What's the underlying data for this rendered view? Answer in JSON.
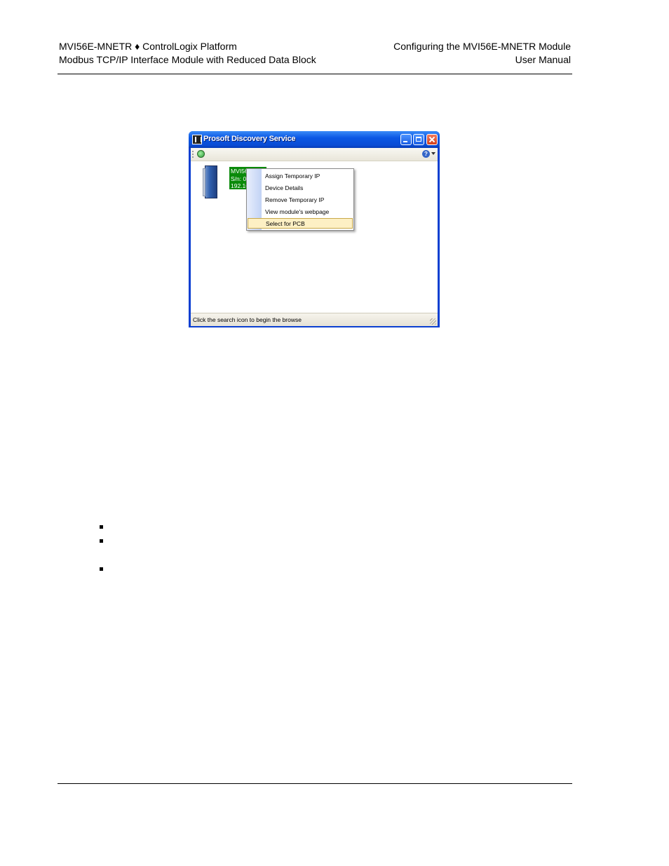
{
  "header": {
    "left_line1": "MVI56E-MNETR ♦ ControlLogix Platform",
    "left_line2": "Modbus TCP/IP Interface Module with Reduced Data Block",
    "right_line1": "Configuring the MVI56E-MNETR Module",
    "right_line2": "User Manual"
  },
  "window": {
    "title": "Prosoft Discovery Service",
    "device_label": {
      "line1": "MVI56E",
      "line2": "S/n: 00",
      "line3": "192.16"
    },
    "context_menu": [
      "Assign Temporary IP",
      "Device Details",
      "Remove Temporary IP",
      "View module's webpage",
      "Select for PCB"
    ],
    "status_text": "Click the search icon to begin the browse"
  },
  "colors": {
    "title_bar": "#0b57e4",
    "device_label_bg": "#0a8a0a",
    "menu_highlight": "#fdf0c4"
  }
}
